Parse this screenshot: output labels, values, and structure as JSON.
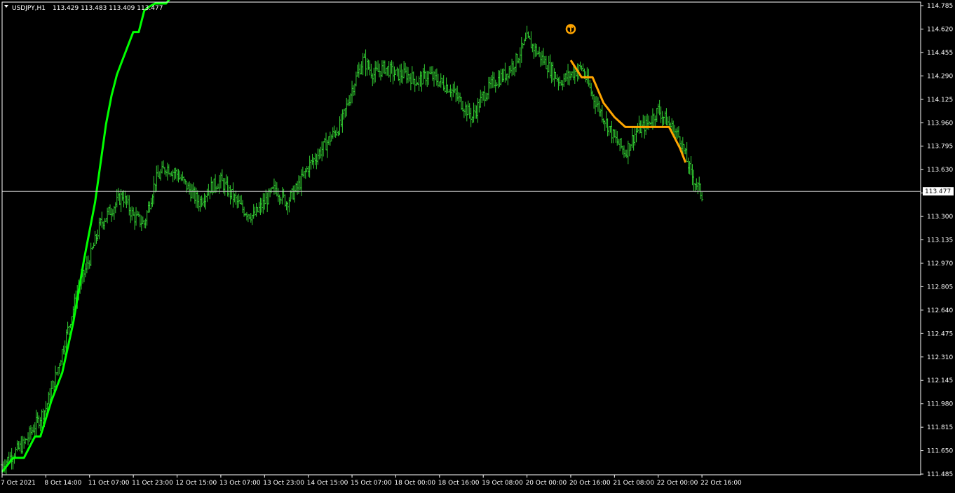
{
  "header": {
    "symbol_tf": "USDJPY,H1",
    "ohlc": "113.429 113.483 113.409 113.477"
  },
  "colors": {
    "background": "#000000",
    "foreground": "#ffffff",
    "candles": "#32cd32",
    "ma_up": "#00ff00",
    "ma_down": "#ffa500",
    "current_price_line": "#c0c0c0",
    "marker": "#ffa500"
  },
  "marker": {
    "icon": "circle-up-arrow-icon",
    "time_index": 104,
    "price": 114.62
  },
  "chart_data": {
    "type": "line",
    "title": "",
    "xlabel": "",
    "ylabel": "",
    "ylim": [
      111.48,
      114.81
    ],
    "grid": false,
    "current_price": "113.477",
    "x_index_range": [
      0,
      168
    ],
    "y_ticks": [
      "114.785",
      "114.620",
      "114.455",
      "114.290",
      "114.125",
      "113.960",
      "113.795",
      "113.630",
      "113.465",
      "113.300",
      "113.135",
      "112.970",
      "112.805",
      "112.640",
      "112.475",
      "112.310",
      "112.145",
      "111.980",
      "111.815",
      "111.650",
      "111.485"
    ],
    "x_ticks": [
      {
        "label": "7 Oct 2021",
        "i": 0
      },
      {
        "label": "8 Oct 14:00",
        "i": 8
      },
      {
        "label": "11 Oct 07:00",
        "i": 16
      },
      {
        "label": "11 Oct 23:00",
        "i": 24
      },
      {
        "label": "12 Oct 15:00",
        "i": 32
      },
      {
        "label": "13 Oct 07:00",
        "i": 40
      },
      {
        "label": "13 Oct 23:00",
        "i": 48
      },
      {
        "label": "14 Oct 15:00",
        "i": 56
      },
      {
        "label": "15 Oct 07:00",
        "i": 64
      },
      {
        "label": "18 Oct 00:00",
        "i": 72
      },
      {
        "label": "18 Oct 16:00",
        "i": 80
      },
      {
        "label": "19 Oct 08:00",
        "i": 88
      },
      {
        "label": "20 Oct 00:00",
        "i": 96
      },
      {
        "label": "20 Oct 16:00",
        "i": 104
      },
      {
        "label": "21 Oct 08:00",
        "i": 112
      },
      {
        "label": "22 Oct 00:00",
        "i": 120
      },
      {
        "label": "22 Oct 16:00",
        "i": 128
      }
    ],
    "series": [
      {
        "kind": "ohlc_bars",
        "close_knots": [
          [
            0,
            111.55
          ],
          [
            4,
            111.7
          ],
          [
            8,
            111.95
          ],
          [
            10,
            112.2
          ],
          [
            12,
            112.5
          ],
          [
            14,
            112.8
          ],
          [
            16,
            113.0
          ],
          [
            18,
            113.25
          ],
          [
            20,
            113.35
          ],
          [
            22,
            113.45
          ],
          [
            24,
            113.3
          ],
          [
            26,
            113.25
          ],
          [
            28,
            113.55
          ],
          [
            30,
            113.65
          ],
          [
            32,
            113.6
          ],
          [
            34,
            113.5
          ],
          [
            36,
            113.4
          ],
          [
            38,
            113.5
          ],
          [
            40,
            113.55
          ],
          [
            42,
            113.45
          ],
          [
            44,
            113.35
          ],
          [
            46,
            113.3
          ],
          [
            48,
            113.4
          ],
          [
            50,
            113.5
          ],
          [
            52,
            113.4
          ],
          [
            54,
            113.5
          ],
          [
            56,
            113.65
          ],
          [
            58,
            113.75
          ],
          [
            60,
            113.85
          ],
          [
            62,
            113.95
          ],
          [
            64,
            114.2
          ],
          [
            66,
            114.4
          ],
          [
            68,
            114.3
          ],
          [
            70,
            114.35
          ],
          [
            72,
            114.3
          ],
          [
            74,
            114.3
          ],
          [
            76,
            114.25
          ],
          [
            78,
            114.3
          ],
          [
            80,
            114.25
          ],
          [
            82,
            114.2
          ],
          [
            84,
            114.1
          ],
          [
            86,
            114.0
          ],
          [
            88,
            114.15
          ],
          [
            90,
            114.25
          ],
          [
            92,
            114.3
          ],
          [
            94,
            114.4
          ],
          [
            96,
            114.55
          ],
          [
            98,
            114.45
          ],
          [
            100,
            114.35
          ],
          [
            102,
            114.25
          ],
          [
            104,
            114.3
          ],
          [
            106,
            114.35
          ],
          [
            108,
            114.15
          ],
          [
            110,
            114.0
          ],
          [
            112,
            113.85
          ],
          [
            114,
            113.75
          ],
          [
            116,
            113.9
          ],
          [
            118,
            113.95
          ],
          [
            120,
            114.05
          ],
          [
            122,
            113.95
          ],
          [
            124,
            113.85
          ],
          [
            126,
            113.6
          ],
          [
            128,
            113.45
          ]
        ]
      },
      {
        "kind": "line",
        "color": "up",
        "points": [
          [
            0,
            111.5
          ],
          [
            2,
            111.6
          ],
          [
            4,
            111.6
          ],
          [
            6,
            111.75
          ],
          [
            7,
            111.75
          ],
          [
            9,
            112.0
          ],
          [
            11,
            112.2
          ],
          [
            13,
            112.55
          ],
          [
            15,
            113.0
          ],
          [
            17,
            113.4
          ],
          [
            19,
            113.95
          ],
          [
            20,
            114.15
          ],
          [
            21,
            114.3
          ],
          [
            22,
            114.4
          ],
          [
            23,
            114.5
          ],
          [
            24,
            114.6
          ],
          [
            25,
            114.6
          ],
          [
            26,
            114.75
          ],
          [
            27,
            114.78
          ],
          [
            28,
            114.8
          ],
          [
            29,
            114.8
          ],
          [
            30,
            114.8
          ],
          [
            31,
            114.85
          ],
          [
            32,
            114.85
          ],
          [
            33,
            114.85
          ],
          [
            34,
            114.85
          ],
          [
            35,
            114.85
          ],
          [
            36,
            114.85
          ],
          [
            37,
            114.85
          ],
          [
            38,
            114.85
          ],
          [
            39,
            114.85
          ],
          [
            40,
            114.85
          ],
          [
            41,
            114.85
          ],
          [
            42,
            114.85
          ],
          [
            43,
            114.85
          ],
          [
            44,
            114.85
          ],
          [
            45,
            114.85
          ],
          [
            46,
            114.85
          ],
          [
            47,
            114.85
          ],
          [
            48,
            114.85
          ],
          [
            49,
            114.85
          ],
          [
            50,
            114.85
          ],
          [
            51,
            114.85
          ],
          [
            52,
            114.85
          ],
          [
            53,
            114.85
          ],
          [
            54,
            114.85
          ],
          [
            55,
            114.85
          ],
          [
            56,
            114.85
          ],
          [
            57,
            114.85
          ],
          [
            58,
            114.85
          ],
          [
            59,
            114.85
          ],
          [
            60,
            114.85
          ],
          [
            61,
            114.85
          ],
          [
            62,
            114.85
          ],
          [
            63,
            114.85
          ],
          [
            64,
            114.85
          ]
        ]
      },
      {
        "kind": "line",
        "color": "down",
        "points": [
          [
            104,
            114.4
          ],
          [
            106,
            114.28
          ],
          [
            108,
            114.28
          ],
          [
            110,
            114.1
          ],
          [
            112,
            114.0
          ],
          [
            114,
            113.93
          ],
          [
            116,
            113.93
          ],
          [
            118,
            113.93
          ],
          [
            120,
            113.93
          ],
          [
            122,
            113.93
          ],
          [
            124,
            113.78
          ],
          [
            125,
            113.68
          ]
        ]
      }
    ]
  }
}
